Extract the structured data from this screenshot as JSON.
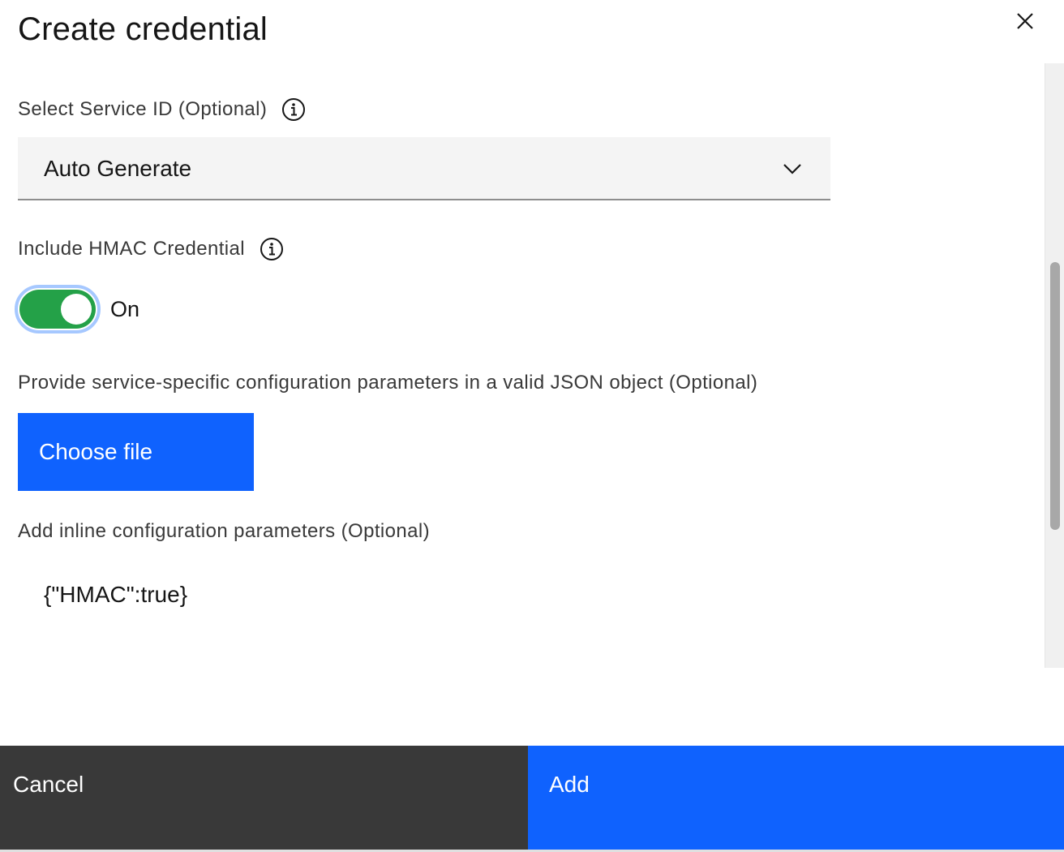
{
  "modal": {
    "title": "Create credential",
    "close_icon": "close-icon"
  },
  "service_id": {
    "label": "Select Service ID (Optional)",
    "info_icon": "info-icon",
    "selected_value": "Auto Generate",
    "dropdown_icon": "chevron-down-icon"
  },
  "hmac": {
    "label": "Include HMAC Credential",
    "info_icon": "info-icon",
    "toggle_state": "On",
    "toggle_color": "#24a148"
  },
  "config_file": {
    "label": "Provide service-specific configuration parameters in a valid JSON object (Optional)",
    "button_label": "Choose file"
  },
  "inline_config": {
    "label": "Add inline configuration parameters (Optional)",
    "value": "{\"HMAC\":true}"
  },
  "footer": {
    "cancel_label": "Cancel",
    "add_label": "Add"
  },
  "colors": {
    "primary": "#0f62fe",
    "secondary": "#393939",
    "focus": "#a6c8ff"
  }
}
